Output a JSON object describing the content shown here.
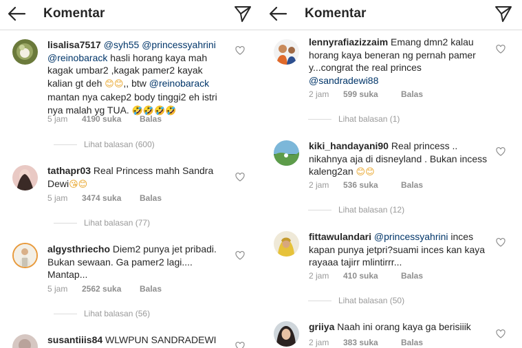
{
  "left": {
    "header": {
      "title": "Komentar"
    },
    "comments": [
      {
        "username": "lisalisa7517",
        "mention1": "@syh55",
        "mention2": "@princessyahrini",
        "mention3": "@reinobarack",
        "text1": " hasli horang kaya mah kagak umbar2 ,kagak pamer2 kayak kalian gt deh ",
        "emoji1": "😊😊",
        "text2": ",, btw ",
        "mention4": "@reinobarack",
        "text3": " mantan nya cakep2 body tinggi2 eh istri nya malah yg TUA. ",
        "emoji2": "🤣🤣🤣🤣",
        "time": "5 jam",
        "likes": "4190 suka",
        "reply": "Balas",
        "view_replies": "Lihat balasan (600)"
      },
      {
        "username": "tathapr03",
        "text1": " Real Princess mahh Sandra Dewi",
        "emoji1": "😘😊",
        "time": "5 jam",
        "likes": "3474 suka",
        "reply": "Balas",
        "view_replies": "Lihat balasan (77)"
      },
      {
        "username": "algysthriecho",
        "text1": " Diem2 punya jet pribadi. Bukan sewaan. Ga pamer2 lagi.... Mantap...",
        "time": "5 jam",
        "likes": "2562 suka",
        "reply": "Balas",
        "view_replies": "Lihat balasan (56)"
      },
      {
        "username": "susantiiis84",
        "text1": " WLWPUN SANDRADEWI"
      }
    ]
  },
  "right": {
    "header": {
      "title": "Komentar"
    },
    "comments": [
      {
        "username": "lennyrafiazizzaim",
        "text1": " Emang dmn2 kalau horang kaya beneran ng pernah pamer y...congrat the real princes ",
        "mention1": "@sandradewi88",
        "time": "2 jam",
        "likes": "599 suka",
        "reply": "Balas",
        "view_replies": "Lihat balasan (1)"
      },
      {
        "username": "kiki_handayani90",
        "text1": " Real princess .. nikahnya aja di disneyland . Bukan incess kaleng2an ",
        "emoji1": "😊😊",
        "time": "2 jam",
        "likes": "536 suka",
        "reply": "Balas",
        "view_replies": "Lihat balasan (12)"
      },
      {
        "username": "fittawulandari",
        "mention1": "@princessyahrini",
        "text1": " inces kapan punya jetpri?suami inces kan kaya rayaaa tajirr mlintirrr...",
        "time": "2 jam",
        "likes": "410 suka",
        "reply": "Balas",
        "view_replies": "Lihat balasan (50)"
      },
      {
        "username": "griiya",
        "text1": " Naah ini orang kaya ga berisiiik",
        "time": "2 jam",
        "likes": "383 suka",
        "reply": "Balas"
      }
    ]
  }
}
